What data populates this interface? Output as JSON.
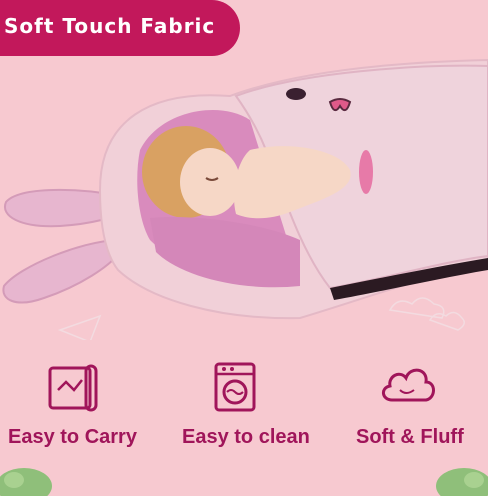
{
  "banner": {
    "title": "Soft Touch Fabric"
  },
  "features": [
    {
      "label": "Easy to Carry",
      "icon": "carry-mat-icon"
    },
    {
      "label": "Easy to clean",
      "icon": "washing-machine-icon"
    },
    {
      "label": "Soft & Fluff",
      "icon": "cloud-fluff-icon"
    }
  ],
  "colors": {
    "background": "#f7c9d0",
    "banner": "#c2185b",
    "accent_text": "#a0155a",
    "bag_outer": "#f1d0d8",
    "bag_lining": "#d98bbd"
  }
}
